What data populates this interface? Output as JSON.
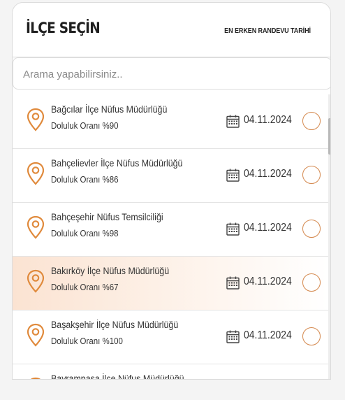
{
  "header": {
    "title": "İLÇE SEÇİN",
    "subtitle": "EN ERKEN RANDEVU TARİHİ"
  },
  "search": {
    "placeholder": "Arama yapabilirsiniz.."
  },
  "colors": {
    "accent": "#e08a3c",
    "highlight_row": "#fbe3d2"
  },
  "icons": {
    "location": "location-pin-icon",
    "calendar": "calendar-icon"
  },
  "rows": [
    {
      "name": "Bağcılar İlçe Nüfus Müdürlüğü",
      "rate": "Doluluk Oranı %90",
      "date": "04.11.2024",
      "selected": false
    },
    {
      "name": "Bahçelievler İlçe Nüfus Müdürlüğü",
      "rate": "Doluluk Oranı %86",
      "date": "04.11.2024",
      "selected": false
    },
    {
      "name": "Bahçeşehir Nüfus Temsilciliği",
      "rate": "Doluluk Oranı %98",
      "date": "04.11.2024",
      "selected": false
    },
    {
      "name": "Bakırköy İlçe Nüfus Müdürlüğü",
      "rate": "Doluluk Oranı %67",
      "date": "04.11.2024",
      "selected": false
    },
    {
      "name": "Başakşehir İlçe Nüfus Müdürlüğü",
      "rate": "Doluluk Oranı %100",
      "date": "04.11.2024",
      "selected": false
    },
    {
      "name": "Bayrampaşa İlçe Nüfus Müdürlüğü",
      "rate": "",
      "date": "",
      "selected": false
    }
  ]
}
